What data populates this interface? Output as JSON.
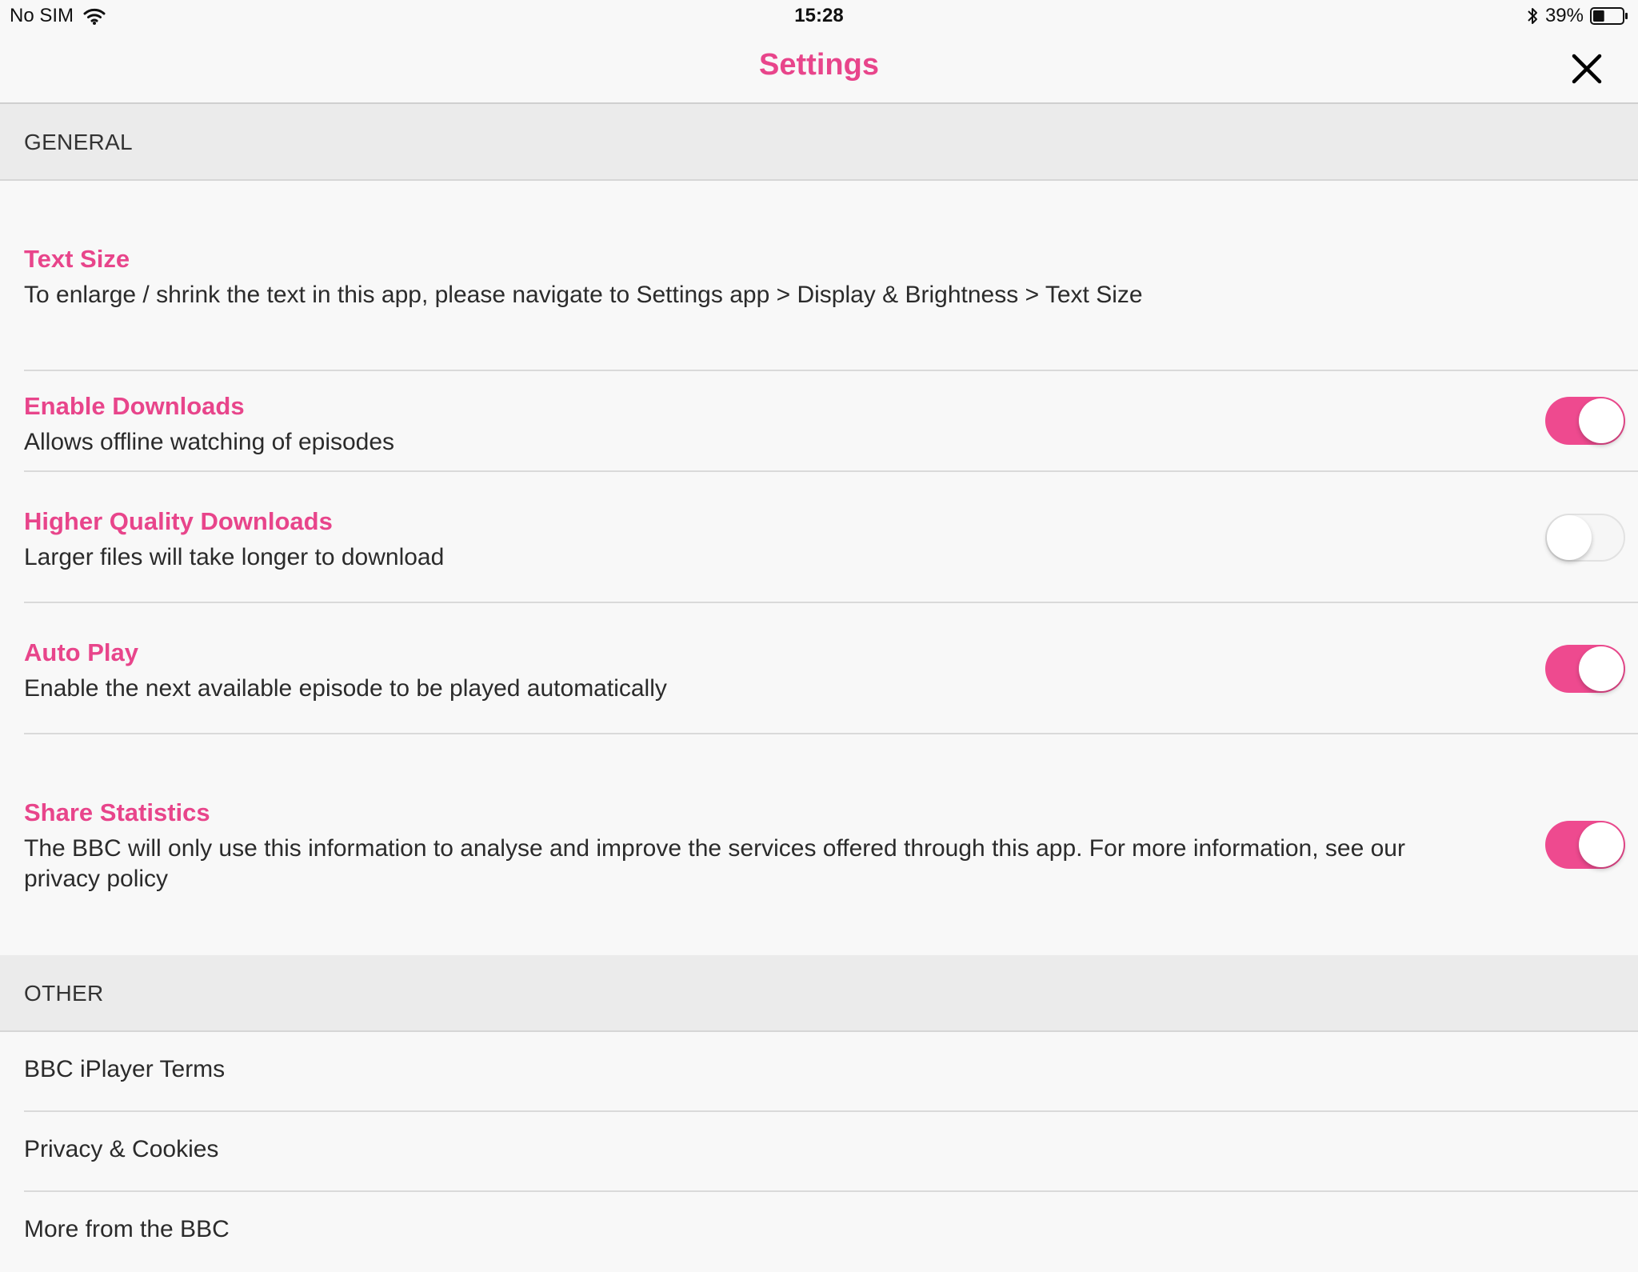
{
  "status_bar": {
    "carrier": "No SIM",
    "time": "15:28",
    "battery_percent": "39%",
    "battery_level": 0.39
  },
  "nav": {
    "title": "Settings"
  },
  "colors": {
    "accent": "#e8458b",
    "toggle_on": "#ee4a8f",
    "section_bg": "#ebebeb",
    "page_bg": "#f8f8f8"
  },
  "sections": {
    "general": {
      "header": "GENERAL",
      "text_size": {
        "title": "Text Size",
        "description": "To enlarge / shrink the text in this app, please navigate to Settings app > Display & Brightness > Text Size"
      },
      "enable_downloads": {
        "title": "Enable Downloads",
        "description": "Allows offline watching of episodes",
        "enabled": true
      },
      "higher_quality_downloads": {
        "title": "Higher Quality Downloads",
        "description": "Larger files will take longer to download",
        "enabled": false
      },
      "auto_play": {
        "title": "Auto Play",
        "description": "Enable the next available episode to be played automatically",
        "enabled": true
      },
      "share_statistics": {
        "title": "Share Statistics",
        "description_line1": "The BBC will only use this information to analyse and improve the services offered through this app. For more information, see our",
        "description_line2": "privacy policy",
        "enabled": true
      }
    },
    "other": {
      "header": "OTHER",
      "items": [
        {
          "label": "BBC iPlayer Terms"
        },
        {
          "label": "Privacy & Cookies"
        },
        {
          "label": "More from the BBC"
        }
      ]
    }
  }
}
